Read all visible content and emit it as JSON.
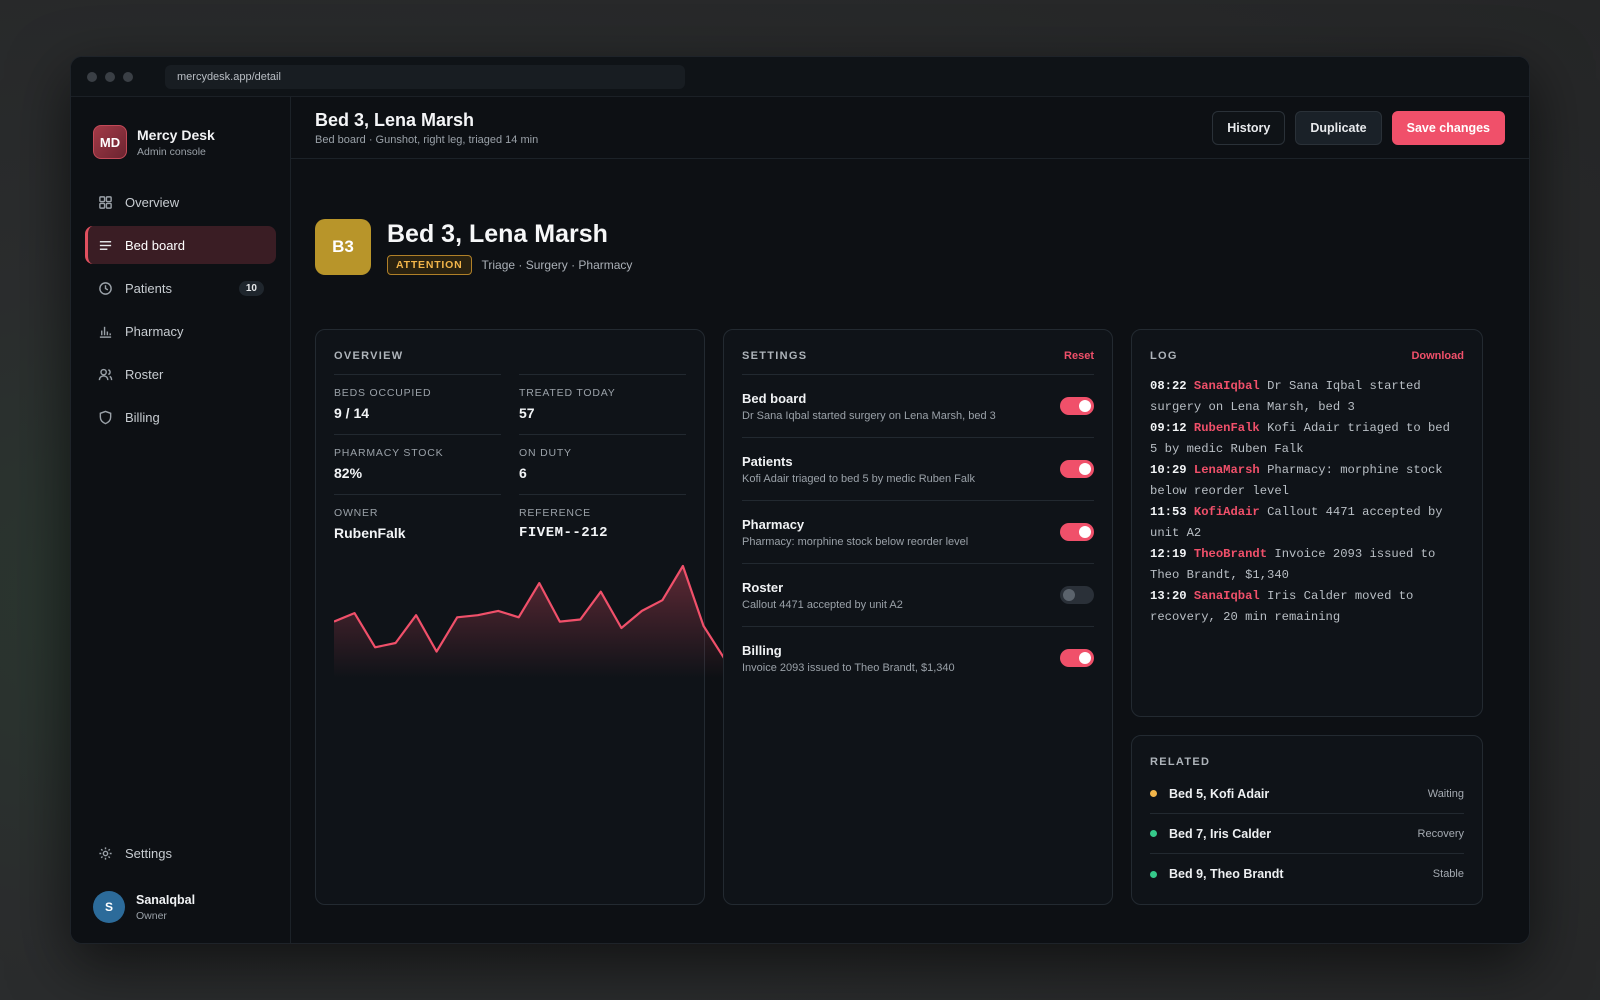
{
  "browser": {
    "url": "mercydesk.app/detail"
  },
  "brand": {
    "initials": "MD",
    "name": "Mercy Desk",
    "subtitle": "Admin console"
  },
  "nav": {
    "items": [
      {
        "label": "Overview",
        "icon": "grid-icon"
      },
      {
        "label": "Bed board",
        "icon": "list-icon",
        "active": true
      },
      {
        "label": "Patients",
        "icon": "clock-icon",
        "badge": "10"
      },
      {
        "label": "Pharmacy",
        "icon": "bar-chart-icon"
      },
      {
        "label": "Roster",
        "icon": "users-icon"
      },
      {
        "label": "Billing",
        "icon": "shield-icon"
      }
    ],
    "settings_label": "Settings"
  },
  "user": {
    "initial": "S",
    "name": "SanaIqbal",
    "role": "Owner"
  },
  "topbar": {
    "title": "Bed 3, Lena Marsh",
    "subtitle": "Bed board · Gunshot, right leg, triaged 14 min",
    "history_label": "History",
    "duplicate_label": "Duplicate",
    "save_label": "Save changes"
  },
  "hero": {
    "badge": "B3",
    "title": "Bed 3, Lena Marsh",
    "status": "ATTENTION",
    "tags": "Triage · Surgery · Pharmacy"
  },
  "overview": {
    "title": "OVERVIEW",
    "stats": [
      {
        "label": "BEDS OCCUPIED",
        "value": "9 / 14"
      },
      {
        "label": "TREATED TODAY",
        "value": "57"
      },
      {
        "label": "PHARMACY STOCK",
        "value": "82%"
      },
      {
        "label": "ON DUTY",
        "value": "6"
      },
      {
        "label": "OWNER",
        "value": "RubenFalk"
      },
      {
        "label": "REFERENCE",
        "value": "FIVEM--212"
      }
    ],
    "sparkline": [
      38,
      42,
      26,
      28,
      41,
      24,
      40,
      41,
      43,
      40,
      56,
      38,
      39,
      52,
      35,
      43,
      48,
      64,
      36,
      21
    ]
  },
  "settings": {
    "title": "SETTINGS",
    "reset_label": "Reset",
    "rows": [
      {
        "name": "Bed board",
        "desc": "Dr Sana Iqbal started surgery on Lena Marsh, bed 3",
        "on": true
      },
      {
        "name": "Patients",
        "desc": "Kofi Adair triaged to bed 5 by medic Ruben Falk",
        "on": true
      },
      {
        "name": "Pharmacy",
        "desc": "Pharmacy: morphine stock below reorder level",
        "on": true
      },
      {
        "name": "Roster",
        "desc": "Callout 4471 accepted by unit A2",
        "on": false
      },
      {
        "name": "Billing",
        "desc": "Invoice 2093 issued to Theo Brandt, $1,340",
        "on": true
      }
    ]
  },
  "log": {
    "title": "LOG",
    "download_label": "Download",
    "entries": [
      {
        "time": "08:22",
        "user": "SanaIqbal",
        "text": "Dr Sana Iqbal started surgery on Lena Marsh, bed 3"
      },
      {
        "time": "09:12",
        "user": "RubenFalk",
        "text": "Kofi Adair triaged to bed 5 by medic Ruben Falk"
      },
      {
        "time": "10:29",
        "user": "LenaMarsh",
        "text": "Pharmacy: morphine stock below reorder level"
      },
      {
        "time": "11:53",
        "user": "KofiAdair",
        "text": "Callout 4471 accepted by unit A2"
      },
      {
        "time": "12:19",
        "user": "TheoBrandt",
        "text": "Invoice 2093 issued to Theo Brandt, $1,340"
      },
      {
        "time": "13:20",
        "user": "SanaIqbal",
        "text": "Iris Calder moved to recovery, 20 min remaining"
      }
    ]
  },
  "related": {
    "title": "RELATED",
    "items": [
      {
        "name": "Bed 5, Kofi Adair",
        "status": "Waiting",
        "color": "#f2b54a"
      },
      {
        "name": "Bed 7, Iris Calder",
        "status": "Recovery",
        "color": "#35c98a"
      },
      {
        "name": "Bed 9, Theo Brandt",
        "status": "Stable",
        "color": "#35c98a"
      }
    ]
  },
  "colors": {
    "accent": "#f0506a",
    "warning": "#f2b54a",
    "success": "#35c98a"
  }
}
